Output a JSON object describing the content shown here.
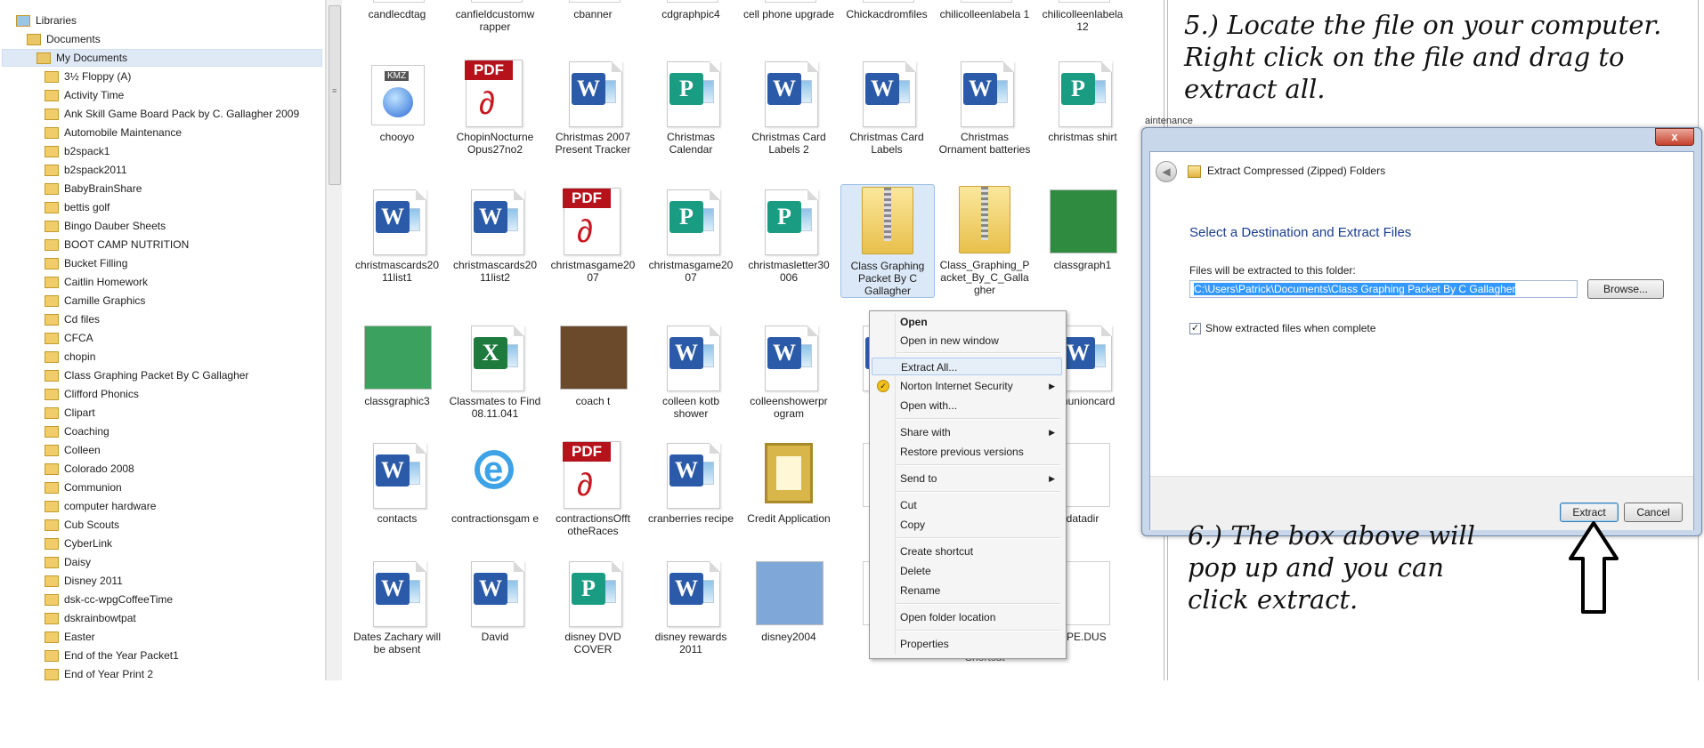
{
  "nav": {
    "libraries": "Libraries",
    "documents": "Documents",
    "my_documents": "My Documents",
    "folders": [
      "3½ Floppy (A)",
      "Activity Time",
      "Ank Skill Game Board Pack by C. Gallagher 2009",
      "Automobile Maintenance",
      "b2spack1",
      "b2spack2011",
      "BabyBrainShare",
      "bettis golf",
      "Bingo Dauber Sheets",
      "BOOT CAMP NUTRITION",
      "Bucket Filling",
      "Caitlin Homework",
      "Camille Graphics",
      "Cd files",
      "CFCA",
      "chopin",
      "Class Graphing Packet By C Gallagher",
      "Clifford Phonics",
      "Clipart",
      "Coaching",
      "Colleen",
      "Colorado 2008",
      "Communion",
      "computer hardware",
      "Cub Scouts",
      "CyberLink",
      "Daisy",
      "Disney 2011",
      "dsk-cc-wpgCoffeeTime",
      "dskrainbowtpat",
      "Easter",
      "End of the Year Packet1",
      "End of Year Print 2"
    ]
  },
  "files": {
    "row0": [
      "candlecdtag",
      "canfieldcustomw rapper",
      "cbanner",
      "cdgraphpic4",
      "cell phone upgrade",
      "Chickacdromfiles",
      "chilicolleenlabela 1",
      "chilicolleenlabela 12"
    ],
    "row1": [
      "chooyo",
      "ChopinNocturne Opus27no2",
      "Christmas 2007 Present Tracker",
      "Christmas Calendar",
      "Christmas Card Labels 2",
      "Christmas Card Labels",
      "Christmas Ornament batteries",
      "christmas shirt"
    ],
    "row2": [
      "christmascards20 11list1",
      "christmascards20 11list2",
      "christmasgame20 07",
      "christmasgame20 07",
      "christmasletter30 006",
      "Class Graphing Packet By C Gallagher",
      "Class_Graphing_P acket_By_C_Galla gher",
      "classgraph1"
    ],
    "row3": [
      "classgraphic3",
      "Classmates to Find 08.11.041",
      "coach t",
      "colleen kotb shower",
      "colleenshowerpr ogram",
      "co",
      "",
      "mmunioncard"
    ],
    "row4": [
      "contacts",
      "contractionsgam e",
      "contractionsOfft otheRaces",
      "cranberries recipe",
      "Credit Application",
      "d",
      "",
      "datadir"
    ],
    "row5": [
      "Dates Zachary will be absent",
      "David",
      "disney DVD COVER",
      "disney rewards 2011",
      "disney2004",
      "dlg",
      "",
      "DPE.DUS"
    ],
    "pdf_text": "PDF",
    "word_letter": "W",
    "pub_letter": "P",
    "xls_letter": "X",
    "kmz_text": "KMZ",
    "extra_label": "Shortcut"
  },
  "context_menu": {
    "items": [
      "Open",
      "Open in new window",
      "Extract All...",
      "Norton Internet Security",
      "Open with...",
      "Share with",
      "Restore previous versions",
      "Send to",
      "Cut",
      "Copy",
      "Create shortcut",
      "Delete",
      "Rename",
      "Open folder location",
      "Properties"
    ]
  },
  "instructions": {
    "step5_line1": "5.) Locate the file on your computer.",
    "step5_line2": "Right click on the file and drag to",
    "step5_line3": "extract all.",
    "step6_line1": "6.) The box above will",
    "step6_line2": "pop up and you can",
    "step6_line3": "click extract."
  },
  "edge_text": [
    "aintenance",
    "She",
    "NUT",
    "work",
    "cs",
    "Pa",
    "s",
    "wa"
  ],
  "dialog": {
    "title": "Extract Compressed (Zipped) Folders",
    "heading": "Select a Destination and Extract Files",
    "folder_label": "Files will be extracted to this folder:",
    "path": "C:\\Users\\Patrick\\Documents\\Class Graphing Packet By C Gallagher",
    "browse": "Browse...",
    "checkbox_label": "Show extracted files when complete",
    "checked_mark": "✓",
    "extract": "Extract",
    "cancel": "Cancel",
    "close": "x",
    "back": "◀"
  },
  "colors": {
    "accent": "#1a3e8c",
    "selection": "#3399ff",
    "pdf": "#b5121b"
  }
}
